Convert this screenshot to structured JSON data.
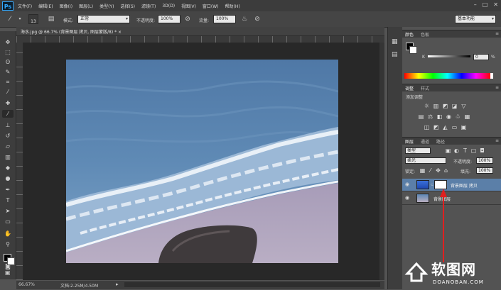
{
  "app": {
    "logo": "Ps"
  },
  "menubar": {
    "items": [
      "文件(F)",
      "编辑(E)",
      "图像(I)",
      "图层(L)",
      "类型(Y)",
      "选择(S)",
      "滤镜(T)",
      "3D(D)",
      "视图(V)",
      "窗口(W)",
      "帮助(H)"
    ],
    "window_controls": [
      "–",
      "□",
      "✕"
    ]
  },
  "options": {
    "brush_size": "13",
    "mode_label": "模式:",
    "mode_value": "正常",
    "opacity_label": "不透明度:",
    "opacity_value": "100%",
    "flow_label": "流量:",
    "flow_value": "100%",
    "workspace": "基本功能"
  },
  "document": {
    "tab_title": "海水.jpg @ 66.7% (背景图层 拷贝, 图层蒙版/8) * ×",
    "zoom": "66.67%",
    "doc_info": "文档:2.25M/4.50M"
  },
  "panels": {
    "color": {
      "tabs": [
        "颜色",
        "色板"
      ],
      "channel": "K",
      "value": "0",
      "unit": "%"
    },
    "adjustments": {
      "tabs": [
        "调整",
        "样式"
      ],
      "title": "添加调整"
    },
    "layers": {
      "tabs": [
        "图层",
        "通道",
        "路径"
      ],
      "filter_kind": "类型",
      "blend_mode": "柔光",
      "opacity_label": "不透明度:",
      "opacity_value": "100%",
      "lock_label": "锁定:",
      "fill_label": "填充:",
      "fill_value": "100%",
      "rows": [
        {
          "name": "背景图层 拷贝",
          "selected": true
        },
        {
          "name": "背景图层",
          "selected": false
        }
      ]
    }
  },
  "watermark": {
    "text": "软图网",
    "sub": "DOANOBAN.COM"
  },
  "colors": {
    "accent": "#31a8ff",
    "selected_layer": "#5b7fa8",
    "arrow": "#e02020"
  }
}
